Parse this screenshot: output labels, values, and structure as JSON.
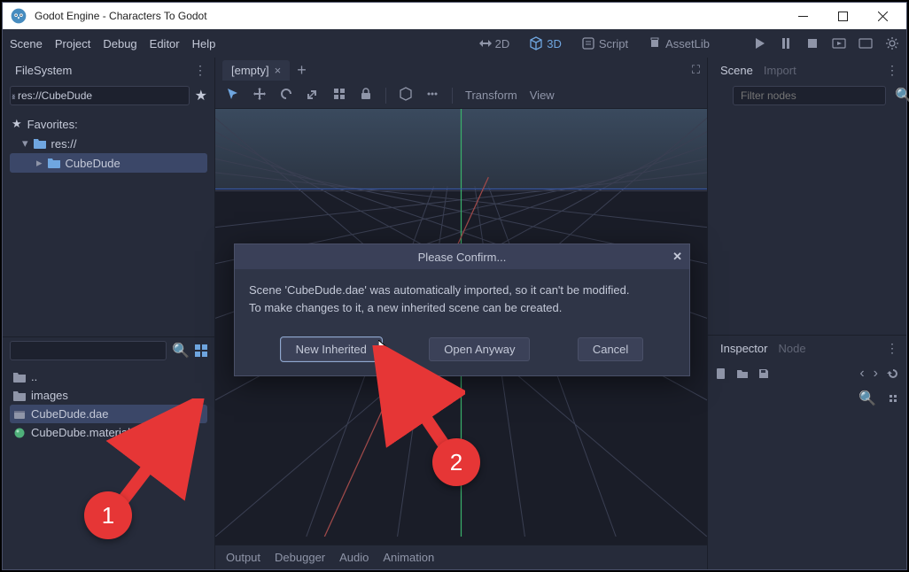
{
  "window": {
    "title": "Godot Engine - Characters To Godot"
  },
  "menus": {
    "scene": "Scene",
    "project": "Project",
    "debug": "Debug",
    "editor": "Editor",
    "help": "Help"
  },
  "workspace": {
    "2d": "2D",
    "3d": "3D",
    "script": "Script",
    "assetlib": "AssetLib"
  },
  "filesystem": {
    "title": "FileSystem",
    "path": "res://CubeDude",
    "favorites": "Favorites:",
    "root": "res://",
    "folder": "CubeDude",
    "files": {
      "up": "..",
      "images": "images",
      "dae": "CubeDude.dae",
      "material": "CubeDube.material"
    }
  },
  "scene_tabs": {
    "empty": "[empty]"
  },
  "toolbar3d": {
    "transform": "Transform",
    "view": "View"
  },
  "scene_dock": {
    "scene": "Scene",
    "import": "Import",
    "filter_placeholder": "Filter nodes"
  },
  "inspector_dock": {
    "inspector": "Inspector",
    "node": "Node"
  },
  "bottom": {
    "output": "Output",
    "debugger": "Debugger",
    "audio": "Audio",
    "animation": "Animation"
  },
  "dialog": {
    "title": "Please Confirm...",
    "line1": "Scene 'CubeDude.dae' was automatically imported, so it can't be modified.",
    "line2": "To make changes to it, a new inherited scene can be created.",
    "new_inherited": "New Inherited",
    "open_anyway": "Open Anyway",
    "cancel": "Cancel"
  },
  "annotations": {
    "one": "1",
    "two": "2"
  }
}
